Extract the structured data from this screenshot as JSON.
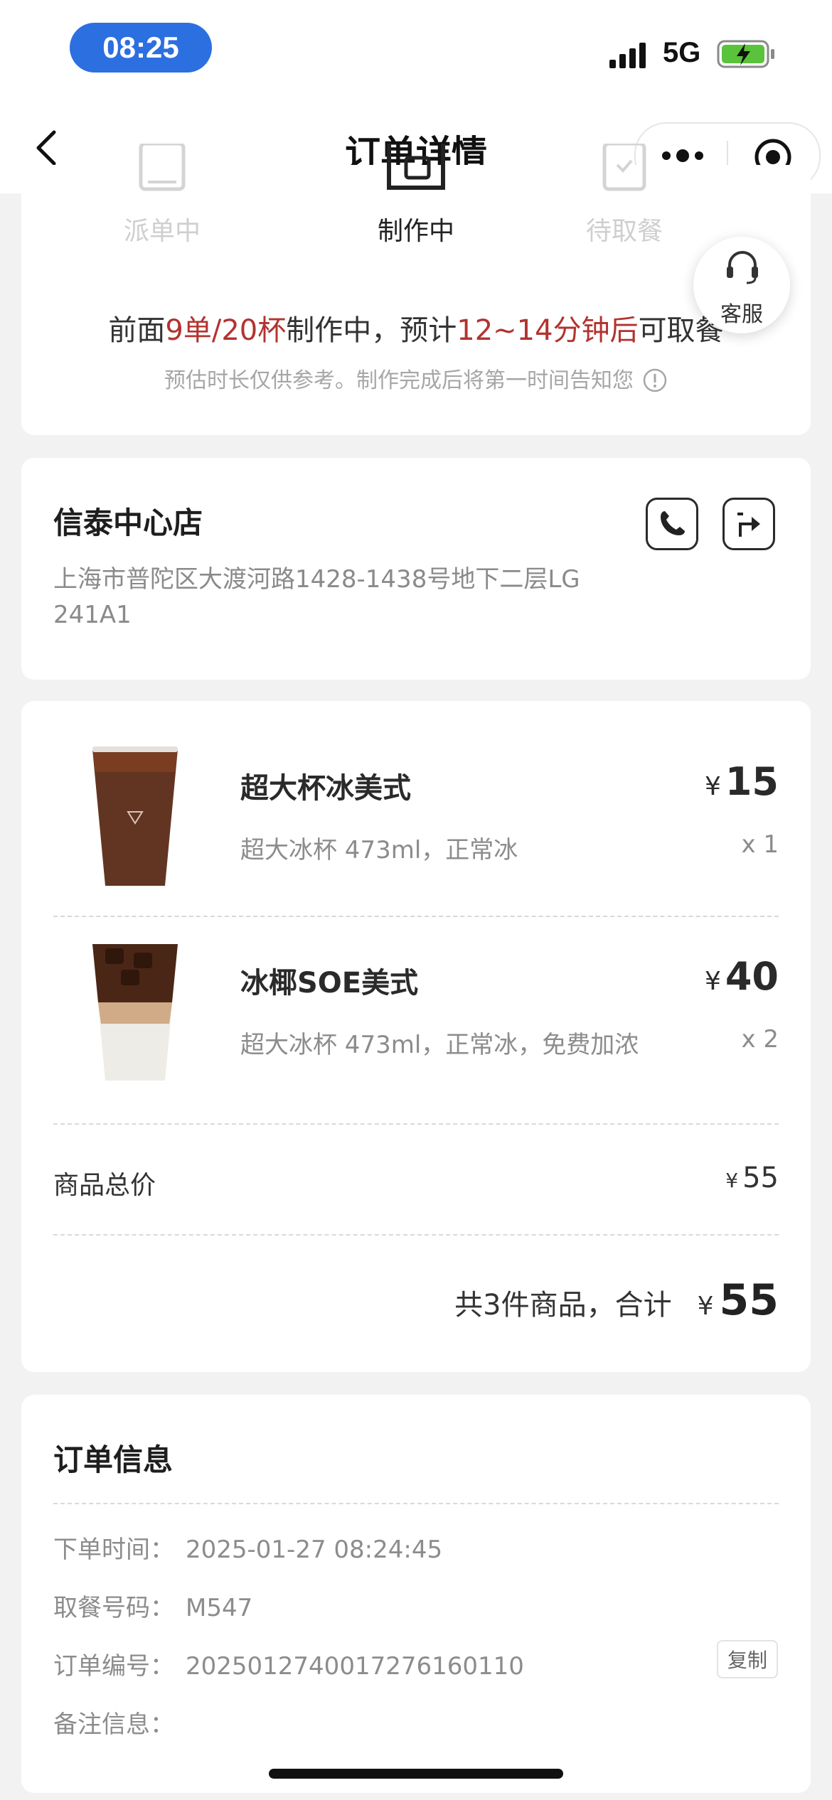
{
  "status_bar": {
    "time": "08:25",
    "network": "5G",
    "icons": [
      "signal-icon",
      "battery-charging-icon"
    ]
  },
  "nav": {
    "title": "订单详情",
    "icons": [
      "back-icon",
      "more-icon",
      "target-icon"
    ]
  },
  "progress": {
    "steps": [
      {
        "label": "派单中",
        "state": "pending",
        "icon": "dispatch-icon"
      },
      {
        "label": "制作中",
        "state": "active",
        "icon": "brewing-icon"
      },
      {
        "label": "待取餐",
        "state": "pending",
        "icon": "pickup-icon"
      }
    ],
    "eta": {
      "prefix": "前面",
      "queue": "9单/20杯",
      "middle": "制作中，预计",
      "time": "12~14分钟后",
      "suffix": "可取餐"
    },
    "note": "预估时长仅供参考。制作完成后将第一时间告知您",
    "customer_service": "客服"
  },
  "store": {
    "name": "信泰中心店",
    "address": "上海市普陀区大渡河路1428-1438号地下二层LG 241A1",
    "icons": [
      "phone-icon",
      "navigation-icon"
    ]
  },
  "items": [
    {
      "name": "超大杯冰美式",
      "spec": "超大冰杯 473ml，正常冰",
      "currency": "¥",
      "price": "15",
      "qty": "x 1"
    },
    {
      "name": "冰椰SOE美式",
      "spec": "超大冰杯 473ml，正常冰，免费加浓",
      "currency": "¥",
      "price": "40",
      "qty": "x 2"
    }
  ],
  "summary": {
    "subtotal_label": "商品总价",
    "currency": "¥",
    "subtotal_value": "55",
    "total_text": "共3件商品，合计",
    "total_value": "55"
  },
  "order_info": {
    "title": "订单信息",
    "rows": [
      {
        "key": "下单时间：",
        "value": "2025-01-27 08:24:45"
      },
      {
        "key": "取餐号码：",
        "value": "M547"
      },
      {
        "key": "订单编号：",
        "value": "20250127400172761601​10"
      },
      {
        "key": "备注信息：",
        "value": ""
      }
    ],
    "copy_label": "复制"
  },
  "colors": {
    "accent_red": "#b2332f",
    "time_pill": "#2c6fe0",
    "battery_green": "#5ac33b"
  }
}
